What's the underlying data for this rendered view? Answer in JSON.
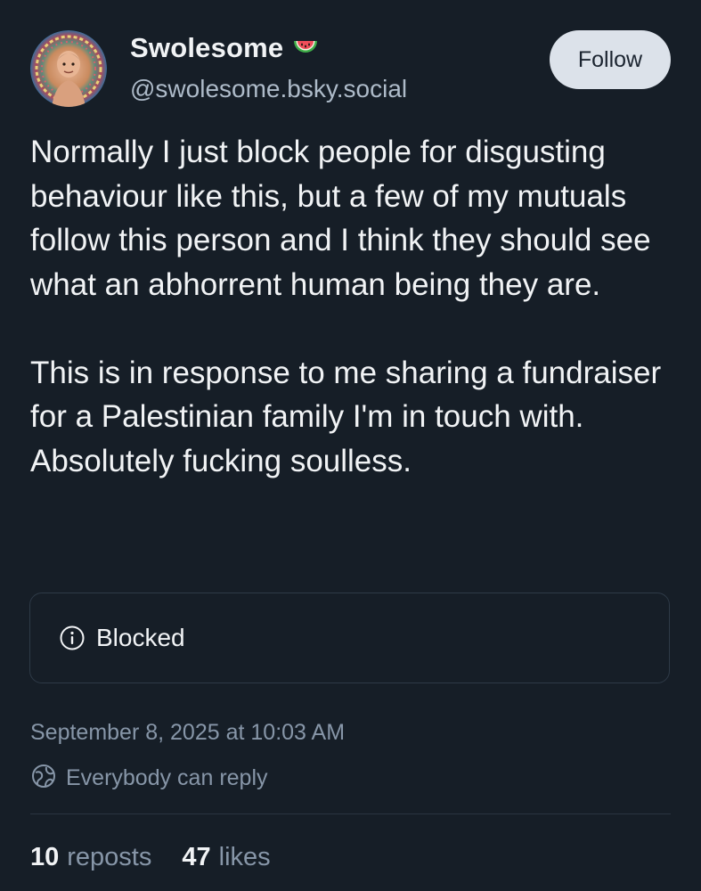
{
  "author": {
    "display_name": "Swolesome",
    "handle": "@swolesome.bsky.social",
    "emoji_icon": "watermelon-icon",
    "avatar_icon": "avatar-photo"
  },
  "follow": {
    "label": "Follow"
  },
  "post": {
    "paragraphs": [
      "Normally I just block people for disgusting behaviour like this, but a few of my mutuals follow this person and I think they should see what an abhorrent human being they are.",
      "This is in response to me sharing a fundraiser for a Palestinian family I'm in touch with. Absolutely fucking soulless."
    ]
  },
  "quote": {
    "icon": "info-icon",
    "label": "Blocked"
  },
  "meta": {
    "timestamp": "September 8, 2025 at 10:03 AM",
    "reply_setting": "Everybody can reply",
    "reply_icon": "globe-icon"
  },
  "stats": {
    "reposts_count": "10",
    "reposts_label": "reposts",
    "likes_count": "47",
    "likes_label": "likes"
  },
  "colors": {
    "background": "#161e27",
    "text": "#f1f3f5",
    "muted": "#8796a8",
    "follow_bg": "#dce2ea"
  }
}
